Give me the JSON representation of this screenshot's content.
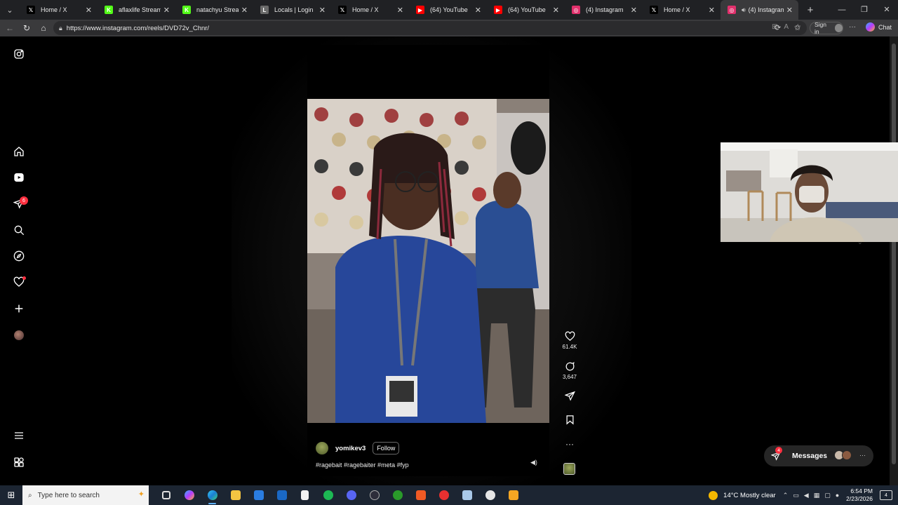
{
  "browser": {
    "tabs": [
      {
        "label": "Home / X",
        "icon": "x-logo-icon",
        "color": "#000000",
        "active": false
      },
      {
        "label": "aflaxlife Stream - Wat",
        "icon": "kick-icon",
        "color": "#53fc18",
        "active": false
      },
      {
        "label": "natachyu Stream - Wa",
        "icon": "kick-icon",
        "color": "#53fc18",
        "active": false
      },
      {
        "label": "Locals | Login",
        "icon": "locals-icon",
        "color": "#6a6a6a",
        "active": false
      },
      {
        "label": "Home / X",
        "icon": "x-logo-icon",
        "color": "#000000",
        "active": false
      },
      {
        "label": "(64) YouTube",
        "icon": "youtube-icon",
        "color": "#ff0000",
        "active": false
      },
      {
        "label": "(64) YouTube",
        "icon": "youtube-icon",
        "color": "#ff0000",
        "active": false
      },
      {
        "label": "(4) Instagram",
        "icon": "instagram-icon",
        "color": "#e1306c",
        "active": false
      },
      {
        "label": "Home / X",
        "icon": "x-logo-icon",
        "color": "#000000",
        "active": false
      },
      {
        "label": "(4) Instagram",
        "icon": "instagram-icon",
        "color": "#e1306c",
        "active": true
      }
    ],
    "url": "https://www.instagram.com/reels/DVD72v_Chnr/",
    "signin_label": "Sign in",
    "copilot_label": "Chat"
  },
  "sidebar": {
    "notifications_count": "6",
    "items": [
      "instagram-logo",
      "home",
      "reels",
      "messages",
      "search",
      "explore",
      "notifications",
      "create",
      "profile",
      "more",
      "also-from-meta"
    ]
  },
  "reel": {
    "username": "yomikev3",
    "follow_label": "Follow",
    "caption": "#ragebait #ragebaiter #meta #fyp",
    "likes": "61.4K",
    "comments": "3,647"
  },
  "messages": {
    "label": "Messages",
    "badge": "4"
  },
  "taskbar": {
    "search_placeholder": "Type here to search",
    "weather": "14°C  Mostly clear",
    "time": "6:54 PM",
    "date": "2/23/2026",
    "notifications": "4"
  },
  "colors": {
    "accent_red": "#ff3040",
    "background": "#000000",
    "tab_bar": "#202124",
    "toolbar": "#3a3a3c",
    "taskbar": "#1c2532"
  }
}
